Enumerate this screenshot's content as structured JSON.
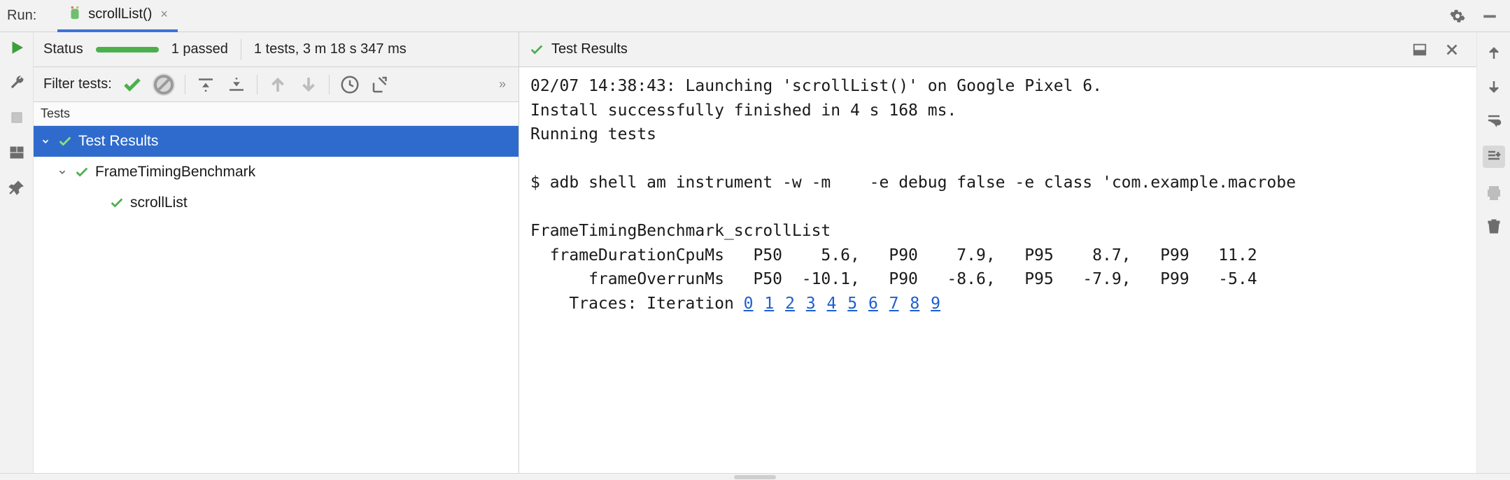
{
  "tabbar": {
    "run_label": "Run:",
    "tab_name": "scrollList()"
  },
  "status": {
    "label": "Status",
    "passed": "1 passed",
    "summary": "1 tests, 3 m 18 s 347 ms"
  },
  "filter": {
    "label": "Filter tests:"
  },
  "tests_header": "Tests",
  "tree": {
    "root": "Test Results",
    "suite": "FrameTimingBenchmark",
    "test": "scrollList"
  },
  "output_header": "Test Results",
  "console": {
    "line1": "02/07 14:38:43: Launching 'scrollList()' on Google Pixel 6.",
    "line2": "Install successfully finished in 4 s 168 ms.",
    "line3": "Running tests",
    "line4": "",
    "line5": "$ adb shell am instrument -w -m    -e debug false -e class 'com.example.macrobe",
    "line6": "",
    "line7": "FrameTimingBenchmark_scrollList",
    "line8": "  frameDurationCpuMs   P50    5.6,   P90    7.9,   P95    8.7,   P99   11.2",
    "line9": "      frameOverrunMs   P50  -10.1,   P90   -8.6,   P95   -7.9,   P99   -5.4",
    "traces_label": "    Traces: Iteration ",
    "trace_links": [
      "0",
      "1",
      "2",
      "3",
      "4",
      "5",
      "6",
      "7",
      "8",
      "9"
    ]
  }
}
